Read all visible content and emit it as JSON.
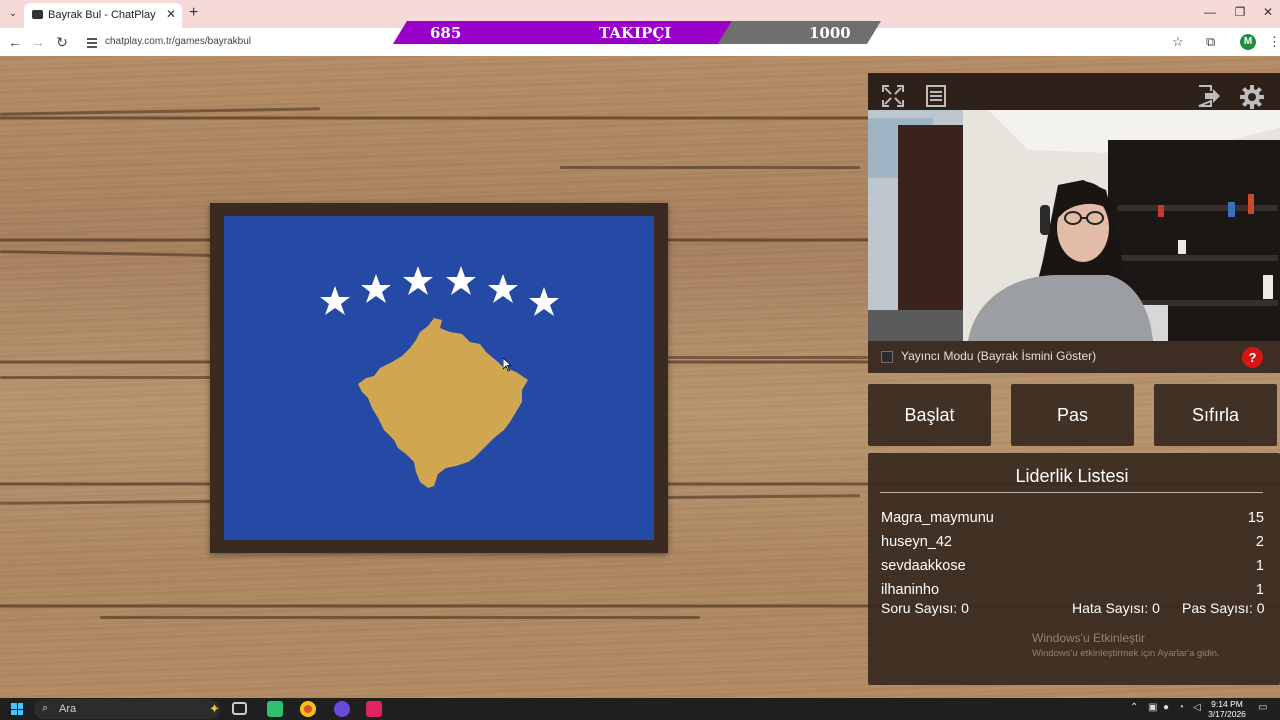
{
  "browser": {
    "tab_title": "Bayrak Bul - ChatPlay",
    "url": "chatplay.com.tr/games/bayrakbul",
    "profile_initial": "M",
    "icons": [
      "tab-list-icon",
      "favicon-icon",
      "close-tab-icon",
      "new-tab-icon",
      "minimize-icon",
      "maximize-icon",
      "close-window-icon",
      "back-icon",
      "forward-icon",
      "reload-icon",
      "site-info-icon",
      "bookmark-star-icon",
      "extensions-icon",
      "menu-icon"
    ]
  },
  "follower_bar": {
    "current": "685",
    "label": "TAKIPÇI",
    "goal": "1000",
    "progress_fraction": 0.685,
    "fill_color": "#9b00c8",
    "track_color": "#6f6f6f"
  },
  "flag": {
    "country_shown": "Kosovo",
    "background_color": "#244aa5",
    "map_color": "#d0a650",
    "star_count": 6
  },
  "side_panel": {
    "streamer_mode_label": "Yayıncı Modu (Bayrak İsmini Göster)",
    "streamer_mode_checked": false,
    "help_label": "?",
    "icons": [
      "fullscreen-icon",
      "list-icon",
      "exit-icon",
      "settings-gear-icon"
    ]
  },
  "controls": {
    "start": "Başlat",
    "pass": "Pas",
    "reset": "Sıfırla"
  },
  "leaderboard": {
    "title": "Liderlik Listesi",
    "rows": [
      {
        "name": "Magra_maymunu",
        "score": "15"
      },
      {
        "name": "huseyn_42",
        "score": "2"
      },
      {
        "name": "sevdaakkose",
        "score": "1"
      },
      {
        "name": "ilhaninho",
        "score": "1"
      }
    ],
    "stats": {
      "questions": "Soru Sayısı: 0",
      "errors": "Hata Sayısı: 0",
      "passes": "Pas Sayısı: 0"
    }
  },
  "watermark": {
    "line1": "Windows'u Etkinleştir",
    "line2": "Windows'u etkinleştirmek için Ayarlar'a gidin."
  },
  "taskbar": {
    "search_placeholder": "Ara",
    "time": "9:14 PM",
    "date": "3/17/2026"
  }
}
